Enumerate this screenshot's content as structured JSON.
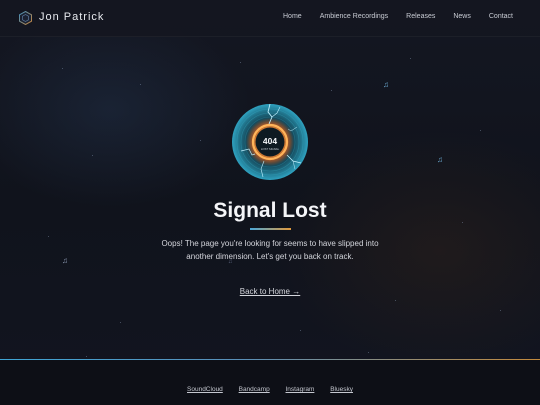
{
  "header": {
    "logo_icon": "hexagon-logo-icon",
    "brand": "Jon Patrick",
    "nav": [
      {
        "label": "Home"
      },
      {
        "label": "Ambience Recordings"
      },
      {
        "label": "Releases"
      },
      {
        "label": "News"
      },
      {
        "label": "Contact"
      }
    ]
  },
  "main": {
    "vinyl_code": "404",
    "vinyl_sub": "LOST SIGNAL",
    "title": "Signal Lost",
    "message": "Oops! The page you're looking for seems to have slipped into another dimension. Let's get you back on track.",
    "back_link": "Back to Home →"
  },
  "footer": {
    "links": [
      {
        "label": "SoundCloud"
      },
      {
        "label": "Bandcamp"
      },
      {
        "label": "Instagram"
      },
      {
        "label": "Bluesky"
      }
    ]
  },
  "colors": {
    "background": "#10131c",
    "accent_blue": "#4aa7d8",
    "accent_orange": "#e39a3b",
    "text": "#f4f5f8"
  },
  "decor": {
    "note_glyph": "♫"
  }
}
